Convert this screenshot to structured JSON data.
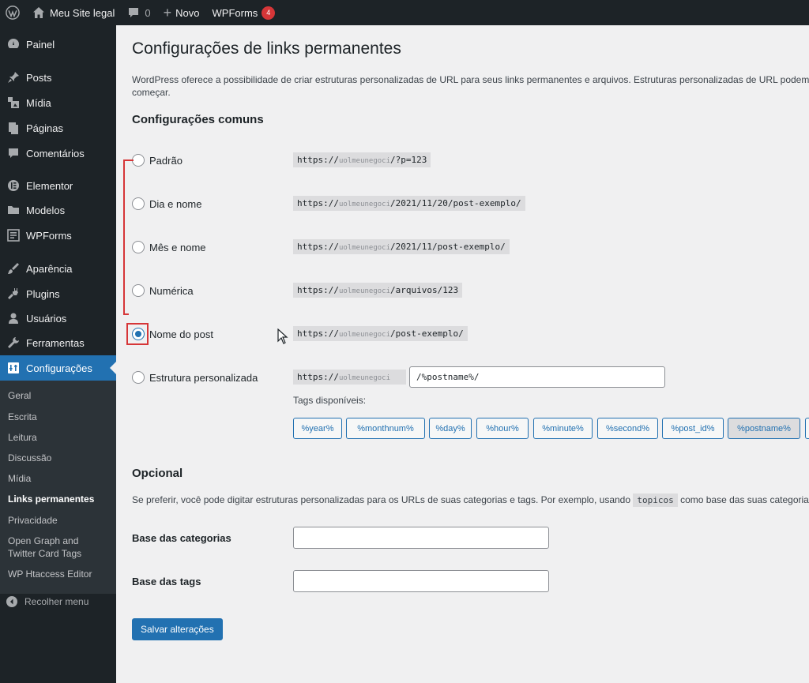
{
  "adminbar": {
    "site_name": "Meu Site legal",
    "comments_count": "0",
    "new_label": "Novo",
    "wpforms_label": "WPForms",
    "wpforms_badge": "4"
  },
  "sidebar": {
    "items": [
      {
        "label": "Painel",
        "icon": "dashboard-icon"
      },
      {
        "label": "Posts",
        "icon": "pin-icon"
      },
      {
        "label": "Mídia",
        "icon": "media-icon"
      },
      {
        "label": "Páginas",
        "icon": "pages-icon"
      },
      {
        "label": "Comentários",
        "icon": "comments-icon"
      },
      {
        "label": "Elementor",
        "icon": "elementor-icon"
      },
      {
        "label": "Modelos",
        "icon": "folder-icon"
      },
      {
        "label": "WPForms",
        "icon": "forms-icon"
      },
      {
        "label": "Aparência",
        "icon": "brush-icon"
      },
      {
        "label": "Plugins",
        "icon": "plugin-icon"
      },
      {
        "label": "Usuários",
        "icon": "users-icon"
      },
      {
        "label": "Ferramentas",
        "icon": "wrench-icon"
      },
      {
        "label": "Configurações",
        "icon": "settings-icon"
      }
    ],
    "submenu": [
      "Geral",
      "Escrita",
      "Leitura",
      "Discussão",
      "Mídia",
      "Links permanentes",
      "Privacidade",
      "Open Graph and Twitter Card Tags",
      "WP Htaccess Editor"
    ],
    "collapse_label": "Recolher menu"
  },
  "page": {
    "title": "Configurações de links permanentes",
    "intro_line1": "WordPress oferece a possibilidade de criar estruturas personalizadas de URL para seus links permanentes e arquivos. Estruturas personalizadas de URL podem mel",
    "intro_line2": "começar.",
    "common_heading": "Configurações comuns",
    "options": [
      {
        "label": "Padrão",
        "domain": "uolmeunegoci",
        "prefix": "https://",
        "suffix": "/?p=123"
      },
      {
        "label": "Dia e nome",
        "domain": "uolmeunegoci",
        "prefix": "https://",
        "suffix": "/2021/11/20/post-exemplo/"
      },
      {
        "label": "Mês e nome",
        "domain": "uolmeunegoci",
        "prefix": "https://",
        "suffix": "/2021/11/post-exemplo/"
      },
      {
        "label": "Numérica",
        "domain": "uolmeunegoci",
        "prefix": "https://",
        "suffix": "/arquivos/123"
      },
      {
        "label": "Nome do post",
        "domain": "uolmeunegoci",
        "prefix": "https://",
        "suffix": "/post-exemplo/"
      },
      {
        "label": "Estrutura personalizada",
        "domain": "uolmeunegoci",
        "prefix": "https://",
        "suffix": ""
      }
    ],
    "custom_structure_value": "/%postname%/",
    "tags_label": "Tags disponíveis:",
    "tags": [
      "%year%",
      "%monthnum%",
      "%day%",
      "%hour%",
      "%minute%",
      "%second%",
      "%post_id%",
      "%postname%"
    ],
    "optional_heading": "Opcional",
    "optional_text_before": "Se preferir, você pode digitar estruturas personalizadas para os URLs de suas categorias e tags. Por exemplo, usando",
    "optional_keyword": "topicos",
    "optional_text_after": "como base das suas categorias, o",
    "category_base_label": "Base das categorias",
    "tag_base_label": "Base das tags",
    "save_button": "Salvar alterações"
  }
}
